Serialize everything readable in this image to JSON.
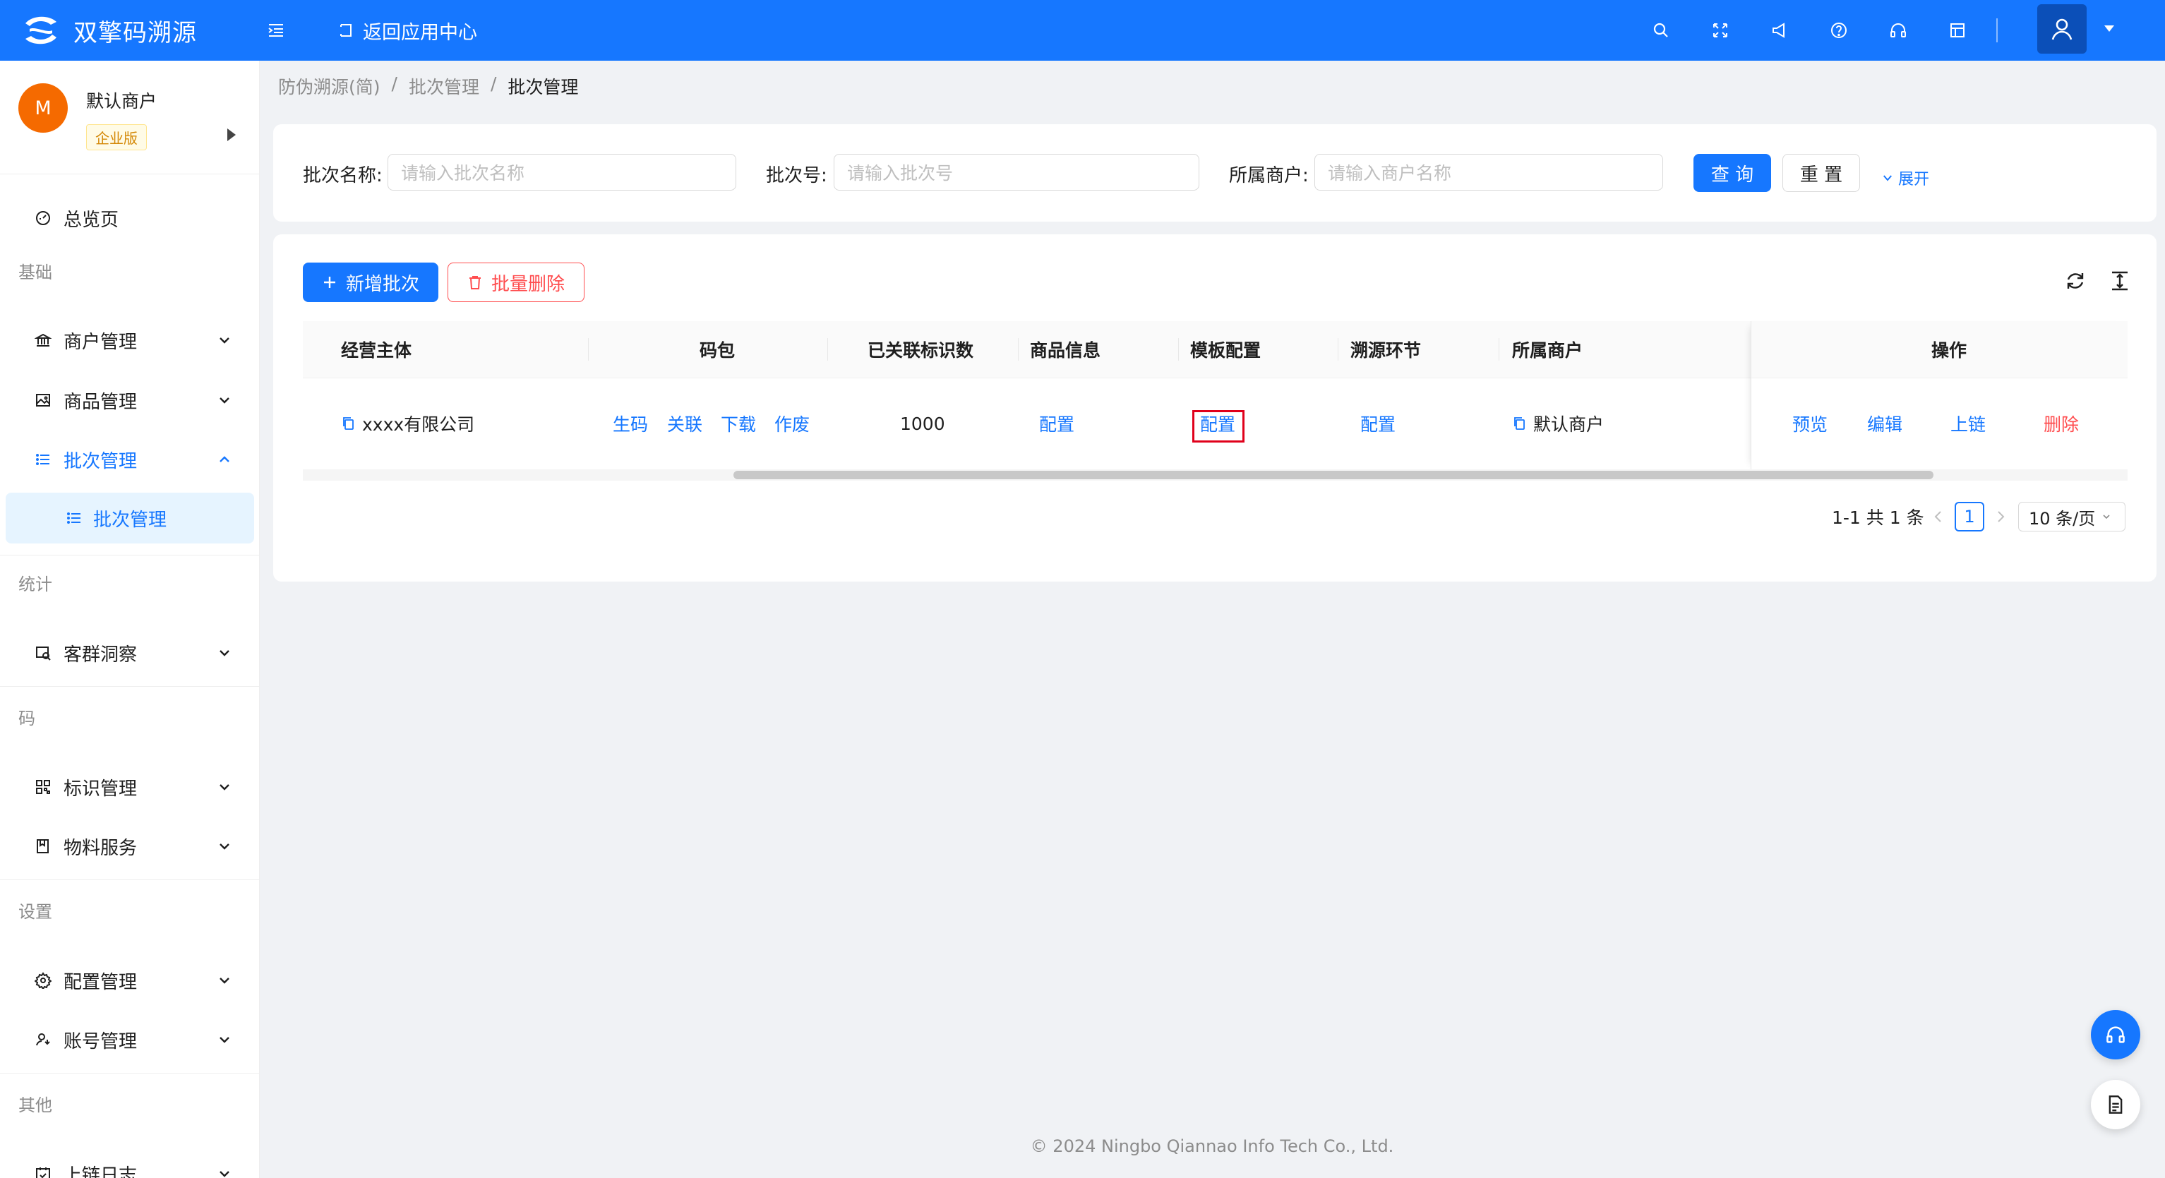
{
  "header": {
    "app_name": "双擎码溯源",
    "back_label": "返回应用中心",
    "icons": [
      "menu-fold-icon",
      "search-icon",
      "fullscreen-icon",
      "notification-icon",
      "help-icon",
      "headset-icon",
      "layout-icon",
      "user-icon",
      "caret-down-icon"
    ],
    "accent": "#1677ff"
  },
  "sidebar": {
    "merchant": {
      "avatar_letter": "M",
      "name": "默认商户",
      "tag": "企业版"
    },
    "overview": "总览页",
    "groups": {
      "basic": "基础",
      "stats": "统计",
      "code": "码",
      "settings": "设置",
      "other": "其他"
    },
    "items": {
      "merchant_mgmt": "商户管理",
      "product_mgmt": "商品管理",
      "batch_mgmt": "批次管理",
      "batch_mgmt_sub": "批次管理",
      "customer_insight": "客群洞察",
      "tag_mgmt": "标识管理",
      "material_service": "物料服务",
      "config_mgmt": "配置管理",
      "account_mgmt": "账号管理",
      "chain_log": "上链日志"
    }
  },
  "breadcrumb": {
    "b1": "防伪溯源(简)",
    "b2": "批次管理",
    "b3": "批次管理",
    "sep": "/"
  },
  "search": {
    "batch_name_label": "批次名称:",
    "batch_name_placeholder": "请输入批次名称",
    "batch_no_label": "批次号:",
    "batch_no_placeholder": "请输入批次号",
    "merchant_label": "所属商户:",
    "merchant_placeholder": "请输入商户名称",
    "query_btn": "查 询",
    "reset_btn": "重 置",
    "expand": "展开"
  },
  "toolbar": {
    "add_btn": "新增批次",
    "batch_delete_btn": "批量删除"
  },
  "table": {
    "columns": {
      "entity": "经营主体",
      "code_pack": "码包",
      "linked_count": "已关联标识数",
      "product_info": "商品信息",
      "template_config": "模板配置",
      "trace_step": "溯源环节",
      "merchant": "所属商户",
      "actions": "操作"
    },
    "rows": [
      {
        "entity": "xxxx有限公司",
        "code_pack_actions": [
          "生码",
          "关联",
          "下载",
          "作废"
        ],
        "linked_count": "1000",
        "product_info": "配置",
        "template_config": "配置",
        "trace_step": "配置",
        "merchant": "默认商户",
        "actions": [
          "预览",
          "编辑",
          "上链",
          "删除"
        ]
      }
    ]
  },
  "pagination": {
    "summary": "1-1 共 1 条",
    "current_page": "1",
    "page_size": "10 条/页"
  },
  "footer": "© 2024 Ningbo Qiannao Info Tech Co., Ltd."
}
